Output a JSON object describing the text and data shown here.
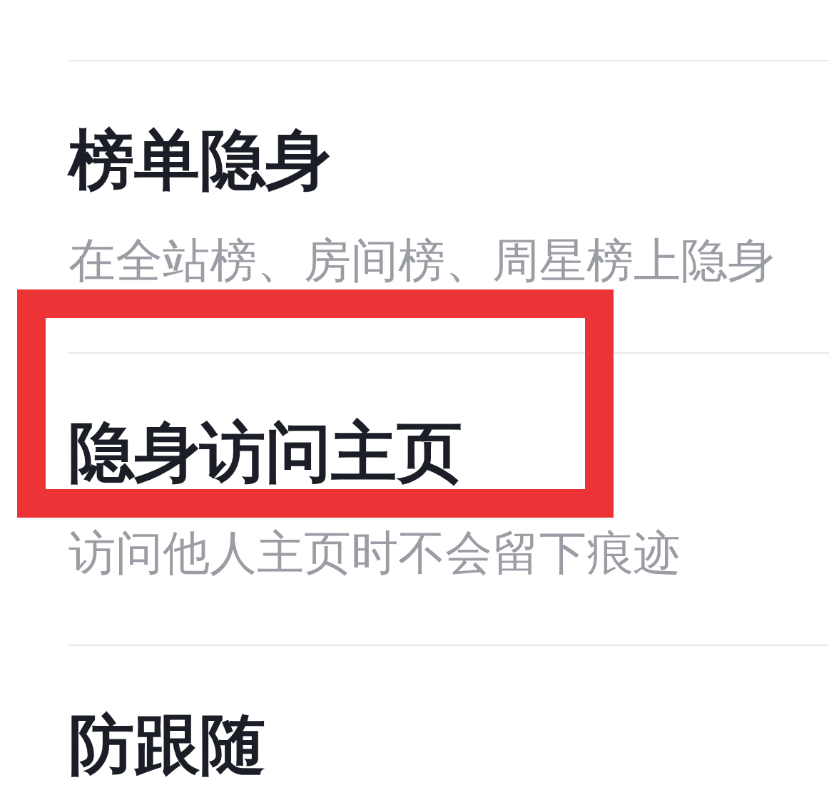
{
  "settings": [
    {
      "title": "榜单隐身",
      "subtitle": "在全站榜、房间榜、周星榜上隐身",
      "highlighted": false
    },
    {
      "title": "隐身访问主页",
      "subtitle": "访问他人主页时不会留下痕迹",
      "highlighted": true
    },
    {
      "title": "防跟随",
      "highlighted": false
    }
  ]
}
